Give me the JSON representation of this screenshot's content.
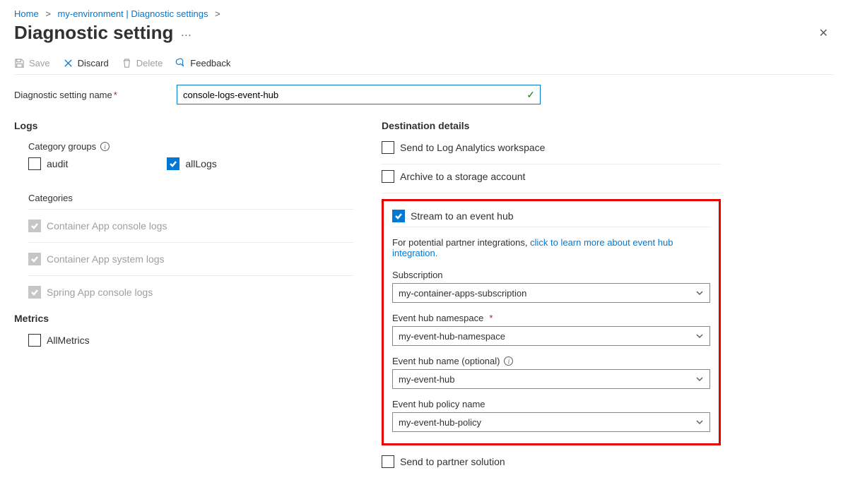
{
  "breadcrumb": {
    "home": "Home",
    "env": "my-environment | Diagnostic settings"
  },
  "title": "Diagnostic setting",
  "toolbar": {
    "save": "Save",
    "discard": "Discard",
    "delete": "Delete",
    "feedback": "Feedback"
  },
  "name_field": {
    "label": "Diagnostic setting name",
    "value": "console-logs-event-hub"
  },
  "logs": {
    "title": "Logs",
    "category_groups_label": "Category groups",
    "audit": "audit",
    "allLogs": "allLogs",
    "categories_label": "Categories",
    "items": [
      "Container App console logs",
      "Container App system logs",
      "Spring App console logs"
    ]
  },
  "metrics": {
    "title": "Metrics",
    "allMetrics": "AllMetrics"
  },
  "dest": {
    "title": "Destination details",
    "law": "Send to Log Analytics workspace",
    "storage": "Archive to a storage account",
    "eventhub": "Stream to an event hub",
    "partner_prefix": "For potential partner integrations, ",
    "partner_link": "click to learn more about event hub integration.",
    "subscription_label": "Subscription",
    "subscription_value": "my-container-apps-subscription",
    "ns_label": "Event hub namespace",
    "ns_value": "my-event-hub-namespace",
    "ehname_label": "Event hub name (optional)",
    "ehname_value": "my-event-hub",
    "policy_label": "Event hub policy name",
    "policy_value": "my-event-hub-policy",
    "partner_solution": "Send to partner solution"
  }
}
